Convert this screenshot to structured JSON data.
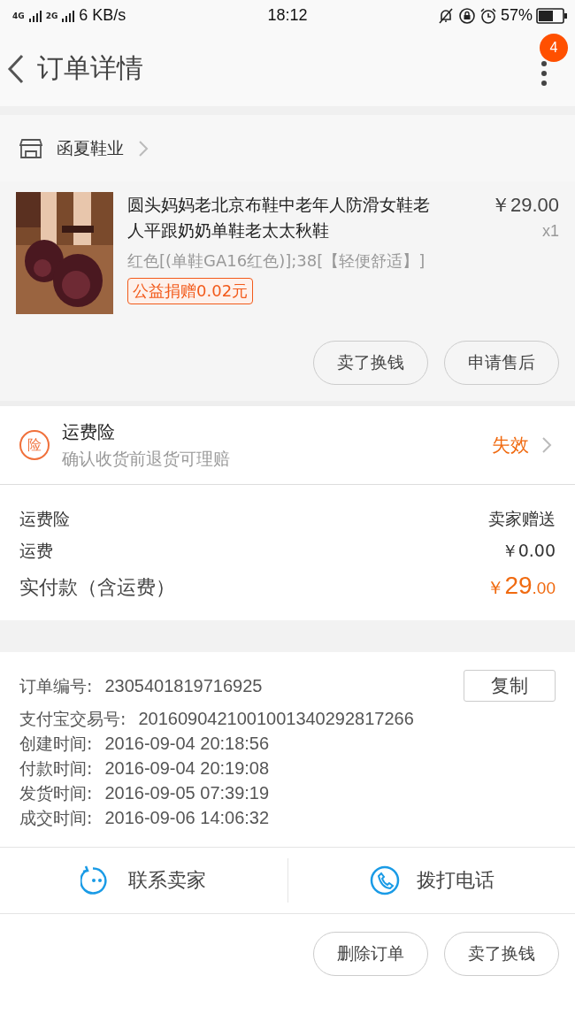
{
  "status_bar": {
    "network_1": "4G",
    "network_2": "2G",
    "speed": "6 KB/s",
    "time": "18:12",
    "battery": "57%"
  },
  "header": {
    "title": "订单详情",
    "badge": "4"
  },
  "shop": {
    "name": "函夏鞋业"
  },
  "product": {
    "image": {
      "kind": "picture"
    },
    "title": "圆头妈妈老北京布鞋中老年人防滑女鞋老人平跟奶奶单鞋老太太秋鞋",
    "price": "￥29.00",
    "quantity": "x1",
    "sku": "红色[(单鞋GA16红色)];38[【轻便舒适】]",
    "tag": "公益捐赠0.02元",
    "buttons": [
      "卖了换钱",
      "申请售后"
    ]
  },
  "insurance": {
    "icon_text": "险",
    "title": "运费险",
    "subtitle": "确认收货前退货可理赔",
    "status": "失效"
  },
  "summary": [
    {
      "label": "运费险",
      "value": "卖家赠送",
      "kind": "normal"
    },
    {
      "label": "运费",
      "value": "￥0.00",
      "kind": "normal"
    },
    {
      "label": "实付款（含运费）",
      "value": "￥",
      "value_main": "29",
      "value_cents": ".00",
      "kind": "total"
    }
  ],
  "order_info": {
    "copy_button": "复制",
    "rows": [
      {
        "label": "订单编号:",
        "value": "2305401819716925"
      },
      {
        "label": "支付宝交易号:",
        "value": "2016090421001001340292817266"
      },
      {
        "label": "创建时间:",
        "value": "2016-09-04 20:18:56"
      },
      {
        "label": "付款时间:",
        "value": "2016-09-04 20:19:08"
      },
      {
        "label": "发货时间:",
        "value": "2016-09-05 07:39:19"
      },
      {
        "label": "成交时间:",
        "value": "2016-09-06 14:06:32"
      }
    ]
  },
  "contact": [
    {
      "label": "联系卖家",
      "kind": "chat"
    },
    {
      "label": "拨打电话",
      "kind": "phone"
    }
  ],
  "footer_buttons": [
    "删除订单",
    "卖了换钱"
  ]
}
